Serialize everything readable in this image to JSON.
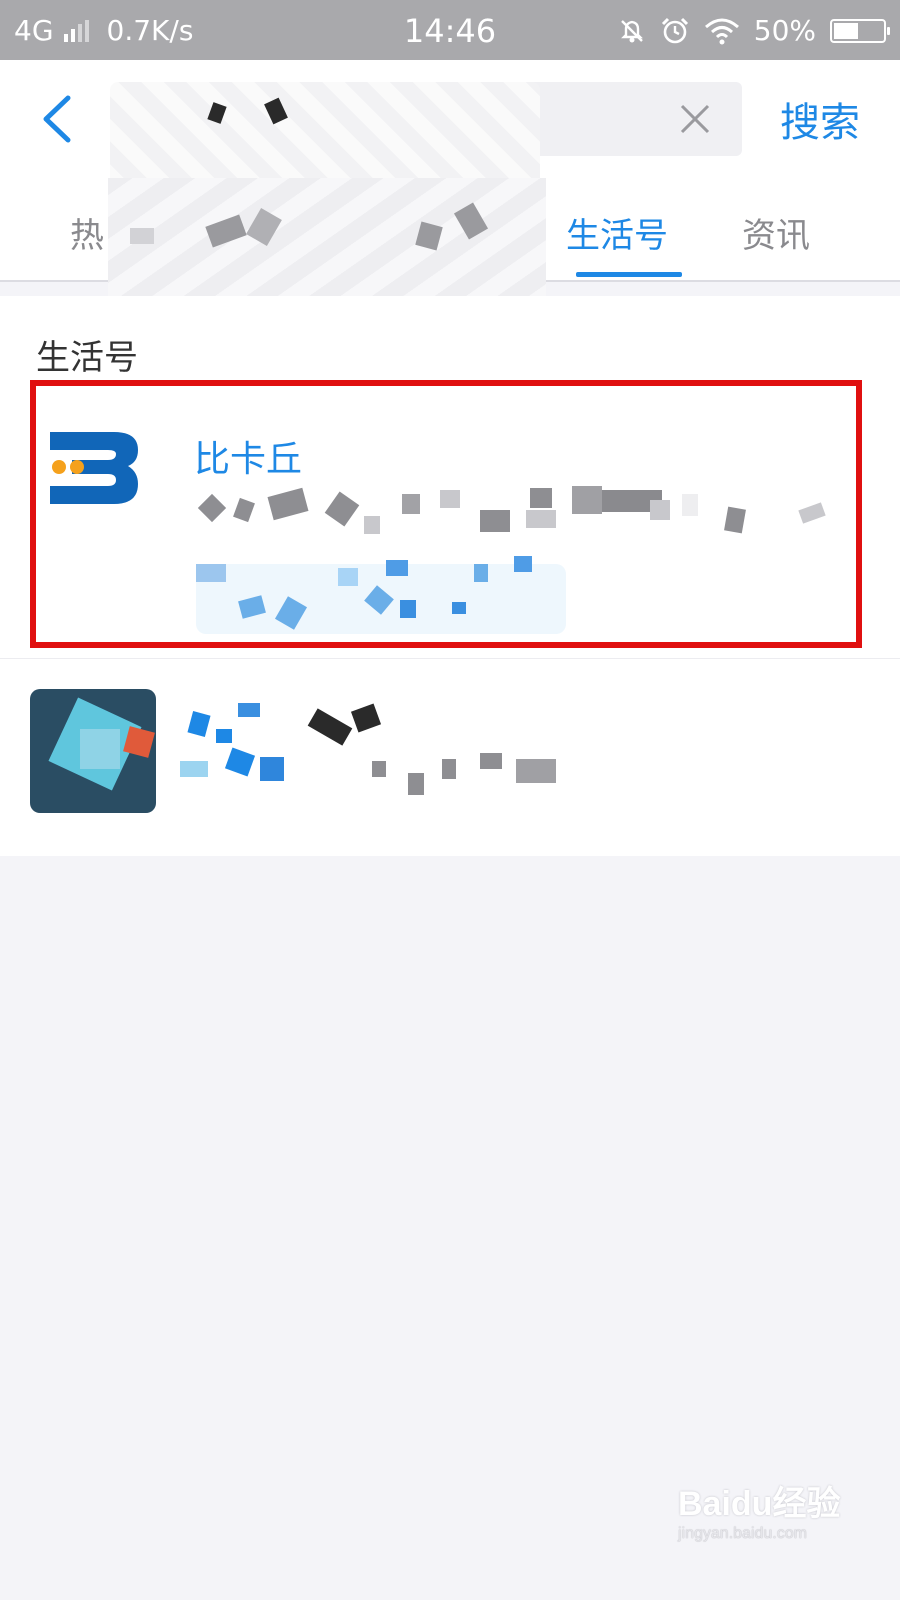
{
  "status_bar": {
    "network": "4G",
    "speed": "0.7K/s",
    "time": "14:46",
    "battery_pct": "50%",
    "battery_level": 0.5
  },
  "search": {
    "query": "",
    "submit_label": "搜索"
  },
  "tabs": [
    {
      "label": "热",
      "active": false
    },
    {
      "label": "生活号",
      "active": true
    },
    {
      "label": "资讯",
      "active": false
    }
  ],
  "results": {
    "section_title": "生活号",
    "items": [
      {
        "name": "比卡丘",
        "highlighted": true
      },
      {
        "name": "",
        "highlighted": false
      }
    ]
  },
  "watermark": {
    "logo": "Baidu经验",
    "url": "jingyan.baidu.com"
  },
  "colors": {
    "accent": "#1e88e5",
    "highlight_border": "#e01010",
    "statusbar_bg": "#a9a9ac"
  },
  "icons": {
    "back": "chevron-left-icon",
    "clear": "close-icon",
    "wifi": "wifi-icon",
    "alarm": "alarm-icon",
    "mute": "bell-off-icon"
  }
}
